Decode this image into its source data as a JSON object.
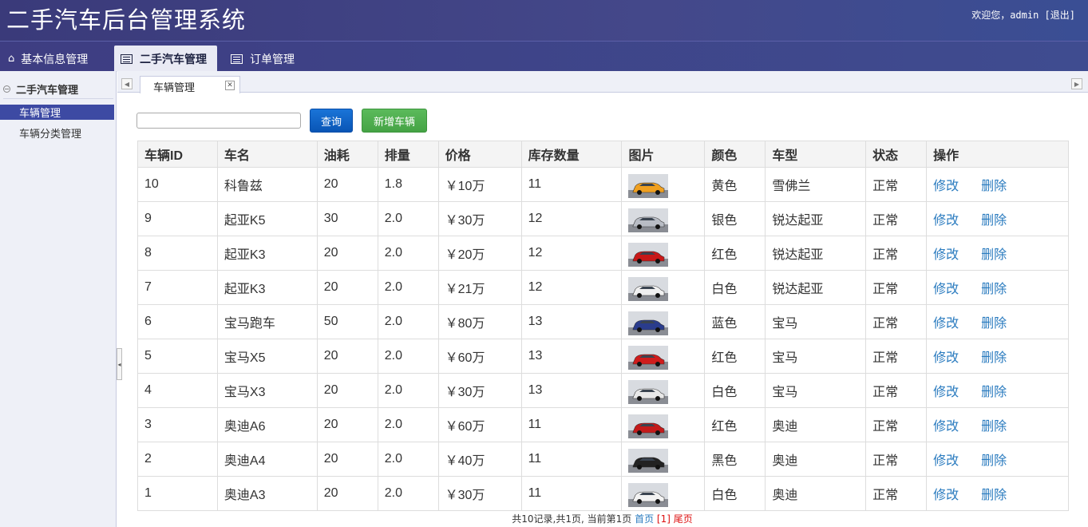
{
  "app": {
    "title": "二手汽车后台管理系统",
    "welcome": "欢迎您，admin",
    "logout": "[退出]"
  },
  "topnav": [
    {
      "label": "基本信息管理",
      "icon": "home-icon",
      "active": false
    },
    {
      "label": "二手汽车管理",
      "icon": "list-icon",
      "active": true
    },
    {
      "label": "订单管理",
      "icon": "list-icon",
      "active": false
    }
  ],
  "sidebar": {
    "group": "二手汽车管理",
    "items": [
      {
        "label": "车辆管理",
        "active": true
      },
      {
        "label": "车辆分类管理",
        "active": false
      }
    ]
  },
  "tab": {
    "label": "车辆管理",
    "close": "✕"
  },
  "toolbar": {
    "search_value": "",
    "query_label": "查询",
    "add_label": "新增车辆"
  },
  "table": {
    "headers": [
      "车辆ID",
      "车名",
      "油耗",
      "排量",
      "价格",
      "库存数量",
      "图片",
      "颜色",
      "车型",
      "状态",
      "操作"
    ],
    "edit_label": "修改",
    "delete_label": "删除",
    "rows": [
      {
        "id": "10",
        "name": "科鲁兹",
        "fuel": "20",
        "disp": "1.8",
        "price": "￥10万",
        "stock": "11",
        "color": "黄色",
        "model": "雪佛兰",
        "status": "正常",
        "car": "#f0a020"
      },
      {
        "id": "9",
        "name": "起亚K5",
        "fuel": "30",
        "disp": "2.0",
        "price": "￥30万",
        "stock": "12",
        "color": "银色",
        "model": "锐达起亚",
        "status": "正常",
        "car": "#b8bcc4"
      },
      {
        "id": "8",
        "name": "起亚K3",
        "fuel": "20",
        "disp": "2.0",
        "price": "￥20万",
        "stock": "12",
        "color": "红色",
        "model": "锐达起亚",
        "status": "正常",
        "car": "#c81818"
      },
      {
        "id": "7",
        "name": "起亚K3",
        "fuel": "20",
        "disp": "2.0",
        "price": "￥21万",
        "stock": "12",
        "color": "白色",
        "model": "锐达起亚",
        "status": "正常",
        "car": "#f0f0f0"
      },
      {
        "id": "6",
        "name": "宝马跑车",
        "fuel": "50",
        "disp": "2.0",
        "price": "￥80万",
        "stock": "13",
        "color": "蓝色",
        "model": "宝马",
        "status": "正常",
        "car": "#2a3c8c"
      },
      {
        "id": "5",
        "name": "宝马X5",
        "fuel": "20",
        "disp": "2.0",
        "price": "￥60万",
        "stock": "13",
        "color": "红色",
        "model": "宝马",
        "status": "正常",
        "car": "#d01c1c"
      },
      {
        "id": "4",
        "name": "宝马X3",
        "fuel": "20",
        "disp": "2.0",
        "price": "￥30万",
        "stock": "13",
        "color": "白色",
        "model": "宝马",
        "status": "正常",
        "car": "#e8e8e8"
      },
      {
        "id": "3",
        "name": "奥迪A6",
        "fuel": "20",
        "disp": "2.0",
        "price": "￥60万",
        "stock": "11",
        "color": "红色",
        "model": "奥迪",
        "status": "正常",
        "car": "#c41a1a"
      },
      {
        "id": "2",
        "name": "奥迪A4",
        "fuel": "20",
        "disp": "2.0",
        "price": "￥40万",
        "stock": "11",
        "color": "黑色",
        "model": "奥迪",
        "status": "正常",
        "car": "#222222"
      },
      {
        "id": "1",
        "name": "奥迪A3",
        "fuel": "20",
        "disp": "2.0",
        "price": "￥30万",
        "stock": "11",
        "color": "白色",
        "model": "奥迪",
        "status": "正常",
        "car": "#f2f2f2"
      }
    ]
  },
  "pager": {
    "summary": "共10记录,共1页, 当前第1页",
    "first": "首页",
    "current": "[1]",
    "last": "尾页"
  }
}
